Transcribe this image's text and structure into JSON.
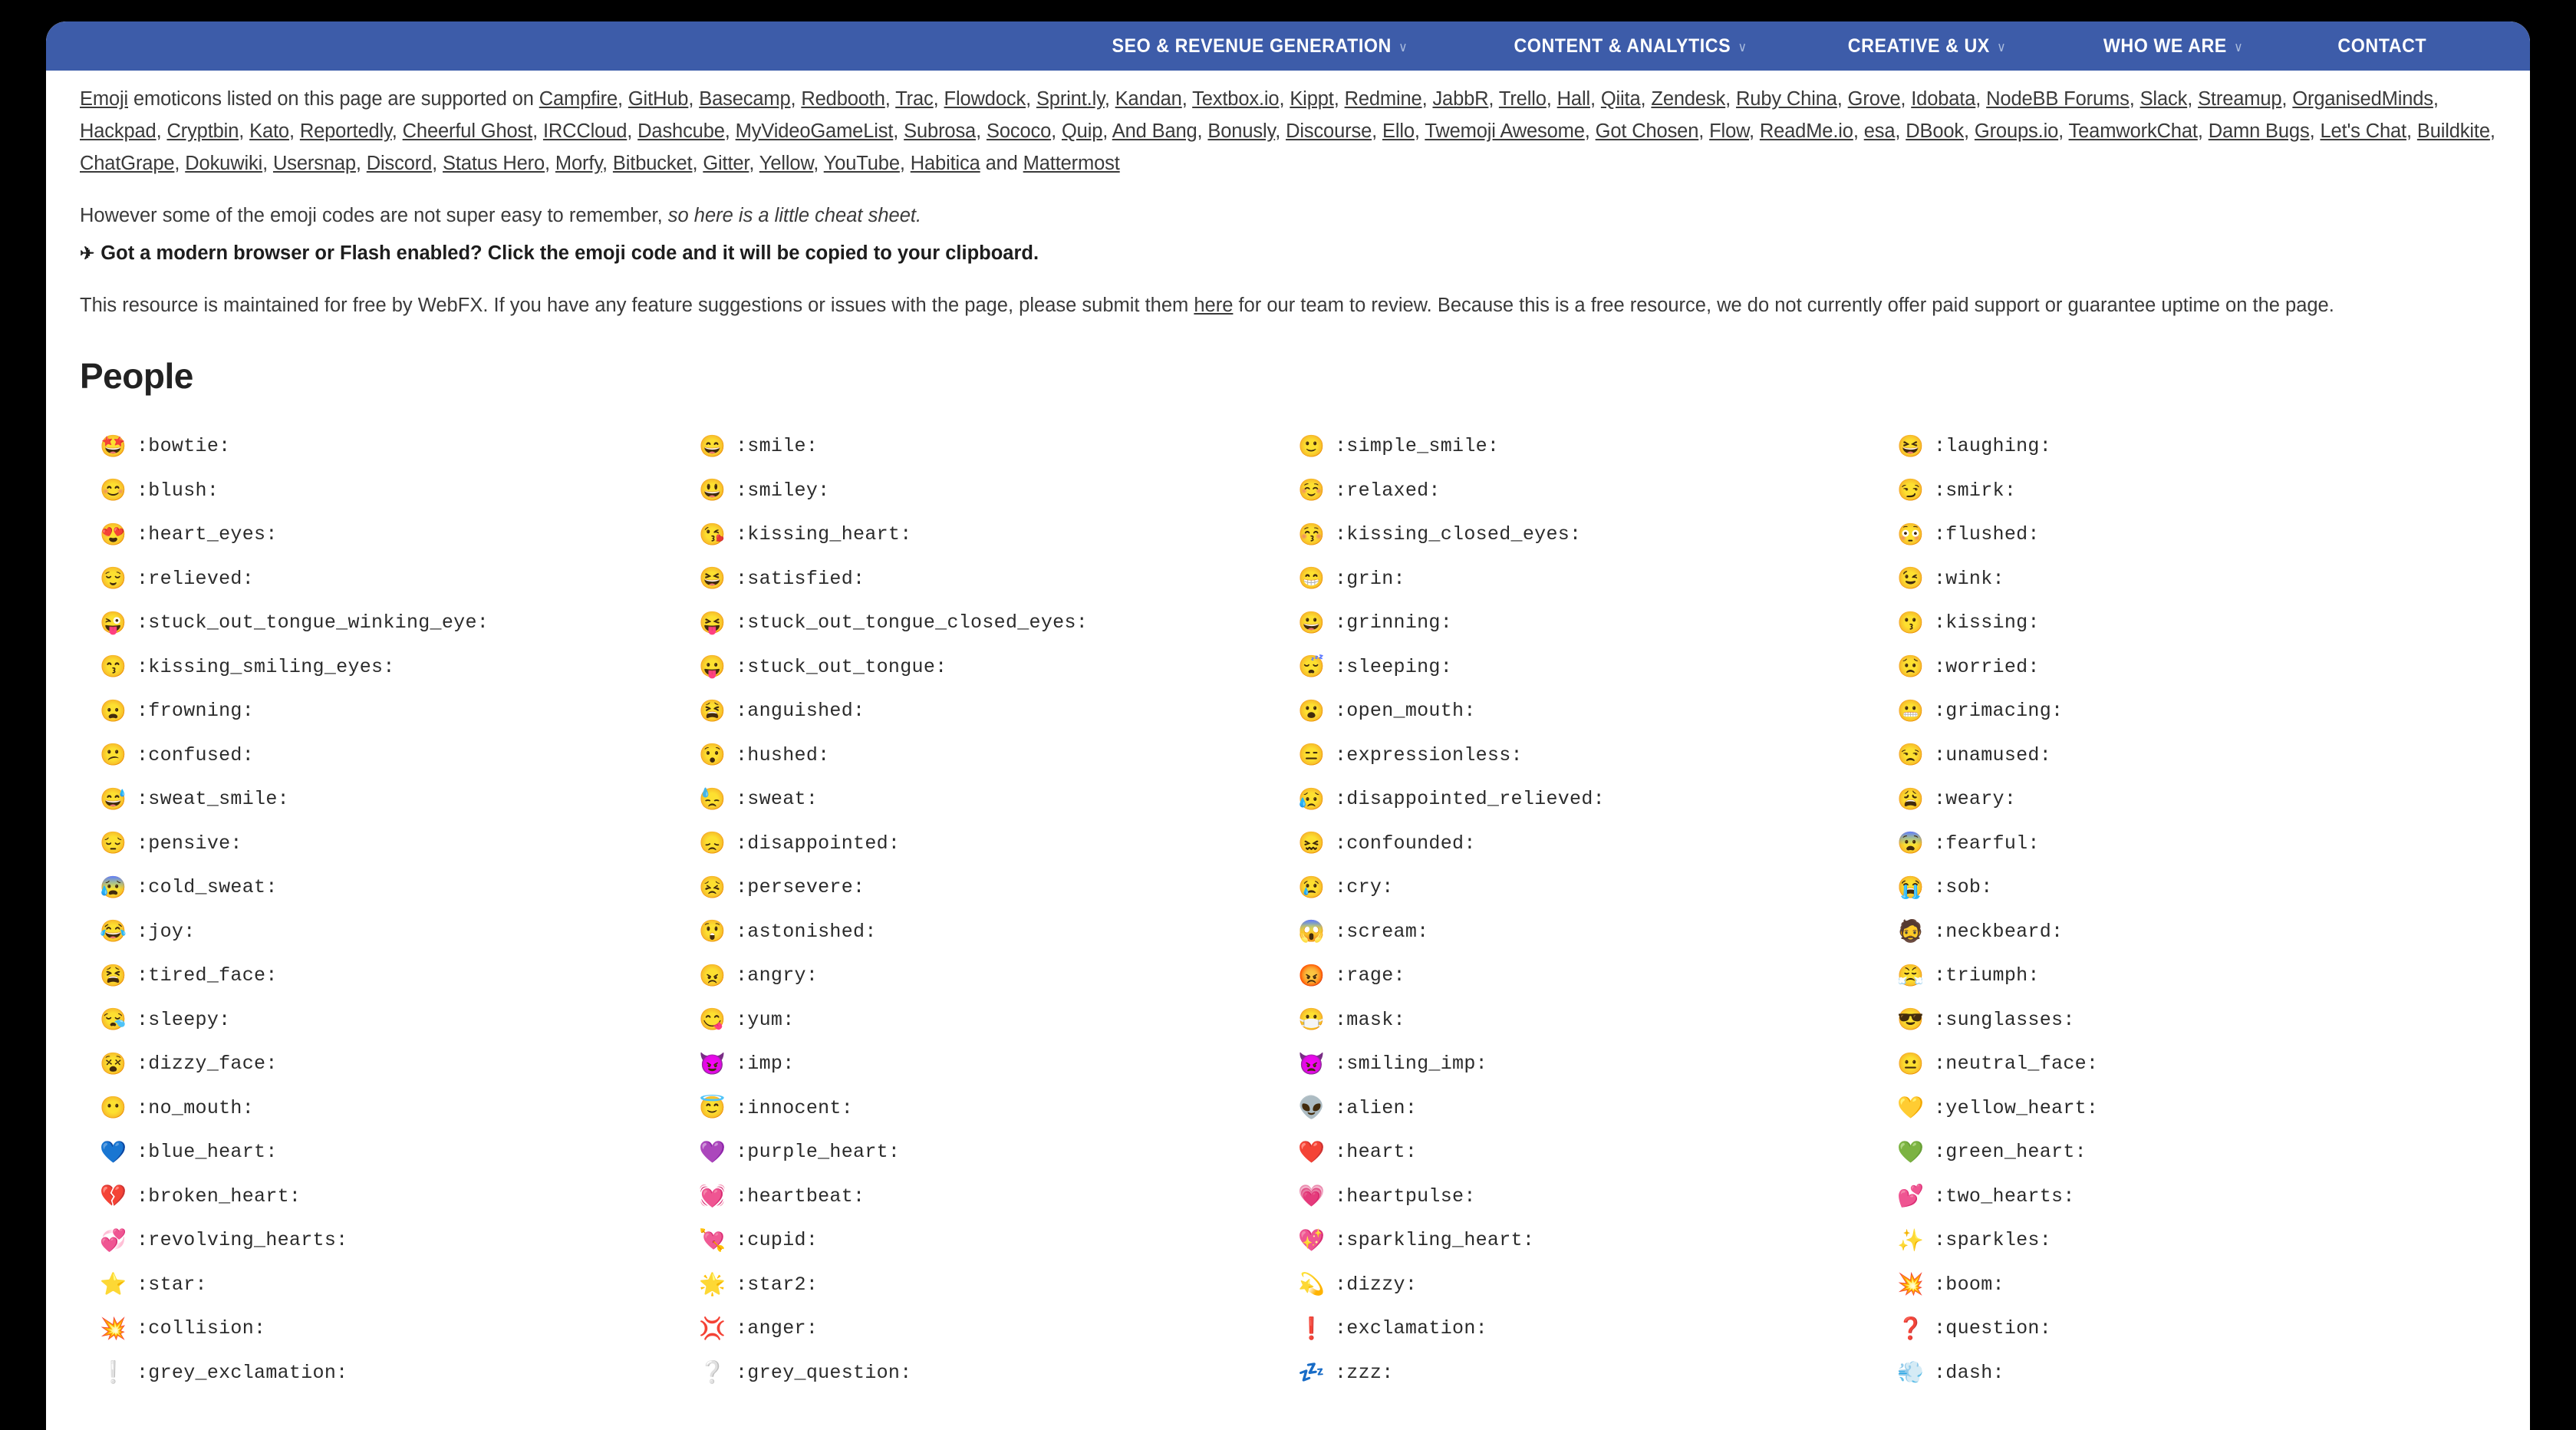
{
  "nav": {
    "items": [
      {
        "label": "SEO & REVENUE GENERATION",
        "caret": "∨",
        "has_caret": true
      },
      {
        "label": "CONTENT & ANALYTICS",
        "caret": "∨",
        "has_caret": true
      },
      {
        "label": "CREATIVE & UX",
        "caret": "∨",
        "has_caret": true
      },
      {
        "label": "WHO WE ARE",
        "caret": "∨",
        "has_caret": true
      },
      {
        "label": "CONTACT",
        "caret": "",
        "has_caret": false
      }
    ],
    "background_color": "#3d5ca9"
  },
  "intro": {
    "lead_link": "Emoji",
    "lead_text": " emoticons listed on this page are supported on ",
    "services": [
      "Campfire",
      "GitHub",
      "Basecamp",
      "Redbooth",
      "Trac",
      "Flowdock",
      "Sprint.ly",
      "Kandan",
      "Textbox.io",
      "Kippt",
      "Redmine",
      "JabbR",
      "Trello",
      "Hall",
      "Qiita",
      "Zendesk",
      "Ruby China",
      "Grove",
      "Idobata",
      "NodeBB Forums",
      "Slack",
      "Streamup",
      "OrganisedMinds",
      "Hackpad",
      "Cryptbin",
      "Kato",
      "Reportedly",
      "Cheerful Ghost",
      "IRCCloud",
      "Dashcube",
      "MyVideoGameList",
      "Subrosa",
      "Sococo",
      "Quip",
      "And Bang",
      "Bonusly",
      "Discourse",
      "Ello",
      "Twemoji Awesome",
      "Got Chosen",
      "Flow",
      "ReadMe.io",
      "esa",
      "DBook",
      "Groups.io",
      "TeamworkChat",
      "Damn Bugs",
      "Let's Chat",
      "Buildkite",
      "ChatGrape",
      "Dokuwiki",
      "Usersnap",
      "Discord",
      "Status Hero",
      "Morfy",
      "Bitbucket",
      "Gitter",
      "Yellow",
      "YouTube",
      "Habitica"
    ],
    "conjunction": " and ",
    "last_service": "Mattermost",
    "however_plain": "However some of the emoji codes are not super easy to remember, ",
    "however_italic": "so here is a little cheat sheet.",
    "plane_icon": "✈",
    "bold_note": "Got a modern browser or Flash enabled? Click the emoji code and it will be copied to your clipboard.",
    "maintained_pre": "This resource is maintained for free by WebFX. If you have any feature suggestions or issues with the page, please submit them ",
    "maintained_link": "here",
    "maintained_post": " for our team to review. Because this is a free resource, we do not currently offer paid support or guarantee uptime on the page."
  },
  "section": {
    "title": "People"
  },
  "emoji": [
    {
      "glyph": "🤩",
      "code": ":bowtie:"
    },
    {
      "glyph": "😄",
      "code": ":smile:"
    },
    {
      "glyph": "🙂",
      "code": ":simple_smile:"
    },
    {
      "glyph": "😆",
      "code": ":laughing:"
    },
    {
      "glyph": "😊",
      "code": ":blush:"
    },
    {
      "glyph": "😃",
      "code": ":smiley:"
    },
    {
      "glyph": "☺️",
      "code": ":relaxed:"
    },
    {
      "glyph": "😏",
      "code": ":smirk:"
    },
    {
      "glyph": "😍",
      "code": ":heart_eyes:"
    },
    {
      "glyph": "😘",
      "code": ":kissing_heart:"
    },
    {
      "glyph": "😚",
      "code": ":kissing_closed_eyes:"
    },
    {
      "glyph": "😳",
      "code": ":flushed:"
    },
    {
      "glyph": "😌",
      "code": ":relieved:"
    },
    {
      "glyph": "😆",
      "code": ":satisfied:"
    },
    {
      "glyph": "😁",
      "code": ":grin:"
    },
    {
      "glyph": "😉",
      "code": ":wink:"
    },
    {
      "glyph": "😜",
      "code": ":stuck_out_tongue_winking_eye:"
    },
    {
      "glyph": "😝",
      "code": ":stuck_out_tongue_closed_eyes:"
    },
    {
      "glyph": "😀",
      "code": ":grinning:"
    },
    {
      "glyph": "😗",
      "code": ":kissing:"
    },
    {
      "glyph": "😙",
      "code": ":kissing_smiling_eyes:"
    },
    {
      "glyph": "😛",
      "code": ":stuck_out_tongue:"
    },
    {
      "glyph": "😴",
      "code": ":sleeping:"
    },
    {
      "glyph": "😟",
      "code": ":worried:"
    },
    {
      "glyph": "😦",
      "code": ":frowning:"
    },
    {
      "glyph": "😫",
      "code": ":anguished:"
    },
    {
      "glyph": "😮",
      "code": ":open_mouth:"
    },
    {
      "glyph": "😬",
      "code": ":grimacing:"
    },
    {
      "glyph": "😕",
      "code": ":confused:"
    },
    {
      "glyph": "😯",
      "code": ":hushed:"
    },
    {
      "glyph": "😑",
      "code": ":expressionless:"
    },
    {
      "glyph": "😒",
      "code": ":unamused:"
    },
    {
      "glyph": "😅",
      "code": ":sweat_smile:"
    },
    {
      "glyph": "😓",
      "code": ":sweat:"
    },
    {
      "glyph": "😥",
      "code": ":disappointed_relieved:"
    },
    {
      "glyph": "😩",
      "code": ":weary:"
    },
    {
      "glyph": "😔",
      "code": ":pensive:"
    },
    {
      "glyph": "😞",
      "code": ":disappointed:"
    },
    {
      "glyph": "😖",
      "code": ":confounded:"
    },
    {
      "glyph": "😨",
      "code": ":fearful:"
    },
    {
      "glyph": "😰",
      "code": ":cold_sweat:"
    },
    {
      "glyph": "😣",
      "code": ":persevere:"
    },
    {
      "glyph": "😢",
      "code": ":cry:"
    },
    {
      "glyph": "😭",
      "code": ":sob:"
    },
    {
      "glyph": "😂",
      "code": ":joy:"
    },
    {
      "glyph": "😲",
      "code": ":astonished:"
    },
    {
      "glyph": "😱",
      "code": ":scream:"
    },
    {
      "glyph": "🧔",
      "code": ":neckbeard:"
    },
    {
      "glyph": "😫",
      "code": ":tired_face:"
    },
    {
      "glyph": "😠",
      "code": ":angry:"
    },
    {
      "glyph": "😡",
      "code": ":rage:"
    },
    {
      "glyph": "😤",
      "code": ":triumph:"
    },
    {
      "glyph": "😪",
      "code": ":sleepy:"
    },
    {
      "glyph": "😋",
      "code": ":yum:"
    },
    {
      "glyph": "😷",
      "code": ":mask:"
    },
    {
      "glyph": "😎",
      "code": ":sunglasses:"
    },
    {
      "glyph": "😵",
      "code": ":dizzy_face:"
    },
    {
      "glyph": "😈",
      "code": ":imp:"
    },
    {
      "glyph": "👿",
      "code": ":smiling_imp:"
    },
    {
      "glyph": "😐",
      "code": ":neutral_face:"
    },
    {
      "glyph": "😶",
      "code": ":no_mouth:"
    },
    {
      "glyph": "😇",
      "code": ":innocent:"
    },
    {
      "glyph": "👽",
      "code": ":alien:"
    },
    {
      "glyph": "💛",
      "code": ":yellow_heart:"
    },
    {
      "glyph": "💙",
      "code": ":blue_heart:"
    },
    {
      "glyph": "💜",
      "code": ":purple_heart:"
    },
    {
      "glyph": "❤️",
      "code": ":heart:"
    },
    {
      "glyph": "💚",
      "code": ":green_heart:"
    },
    {
      "glyph": "💔",
      "code": ":broken_heart:"
    },
    {
      "glyph": "💓",
      "code": ":heartbeat:"
    },
    {
      "glyph": "💗",
      "code": ":heartpulse:"
    },
    {
      "glyph": "💕",
      "code": ":two_hearts:"
    },
    {
      "glyph": "💞",
      "code": ":revolving_hearts:"
    },
    {
      "glyph": "💘",
      "code": ":cupid:"
    },
    {
      "glyph": "💖",
      "code": ":sparkling_heart:"
    },
    {
      "glyph": "✨",
      "code": ":sparkles:"
    },
    {
      "glyph": "⭐",
      "code": ":star:"
    },
    {
      "glyph": "🌟",
      "code": ":star2:"
    },
    {
      "glyph": "💫",
      "code": ":dizzy:"
    },
    {
      "glyph": "💥",
      "code": ":boom:"
    },
    {
      "glyph": "💥",
      "code": ":collision:"
    },
    {
      "glyph": "💢",
      "code": ":anger:"
    },
    {
      "glyph": "❗",
      "code": ":exclamation:"
    },
    {
      "glyph": "❓",
      "code": ":question:"
    },
    {
      "glyph": "❕",
      "code": ":grey_exclamation:"
    },
    {
      "glyph": "❔",
      "code": ":grey_question:"
    },
    {
      "glyph": "💤",
      "code": ":zzz:"
    },
    {
      "glyph": "💨",
      "code": ":dash:"
    }
  ]
}
